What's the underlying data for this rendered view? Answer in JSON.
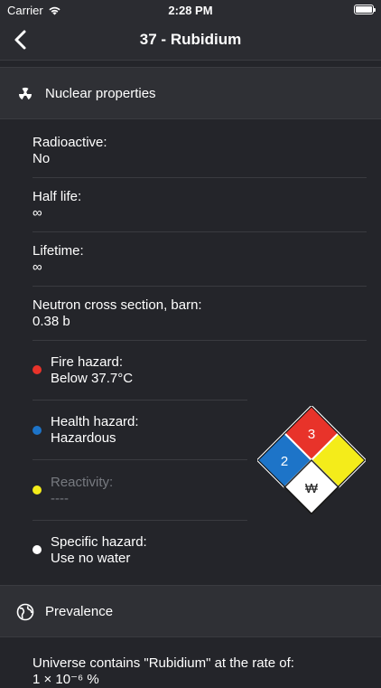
{
  "status": {
    "carrier": "Carrier",
    "time": "2:28 PM"
  },
  "nav": {
    "title": "37 - Rubidium"
  },
  "nuclear": {
    "header": "Nuclear properties",
    "rows": [
      {
        "label": "Radioactive:",
        "value": "No"
      },
      {
        "label": "Half life:",
        "value": "∞"
      },
      {
        "label": "Lifetime:",
        "value": "∞"
      },
      {
        "label": "Neutron cross section, barn:",
        "value": "0.38 b"
      }
    ],
    "hazards": [
      {
        "label": "Fire hazard:",
        "value": "Below 37.7°C",
        "color": "#e8332a"
      },
      {
        "label": "Health hazard:",
        "value": "Hazardous",
        "color": "#1d74c8"
      },
      {
        "label": "Reactivity:",
        "value": "----",
        "color": "#f4ec1a"
      },
      {
        "label": "Specific hazard:",
        "value": "Use no water",
        "color": "#ffffff"
      }
    ],
    "nfpa": {
      "fire": "3",
      "health": "2",
      "reactivity": "",
      "special": "₩"
    }
  },
  "prevalence": {
    "header": "Prevalence",
    "universe_label": "Universe contains \"Rubidium\" at the rate of:",
    "universe_value": "1 × 10⁻⁶ %"
  }
}
